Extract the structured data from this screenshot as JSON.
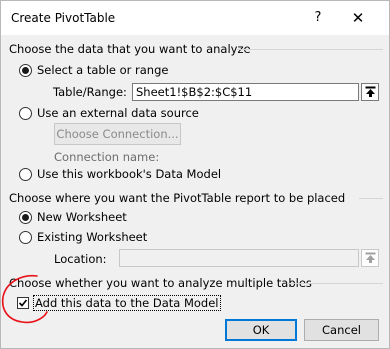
{
  "dialog": {
    "title": "Create PivotTable",
    "help_label": "?",
    "close_label": "✕"
  },
  "section_data": {
    "heading": "Choose the data that you want to analyze",
    "select_table_label": "Select a table or range",
    "select_table_selected": true,
    "table_range_label": "Table/Range:",
    "table_range_value": "Sheet1!$B$2:$C$11",
    "external_source_label": "Use an external data source",
    "external_source_selected": false,
    "choose_connection_label": "Choose Connection...",
    "connection_name_label": "Connection name:",
    "data_model_label": "Use this workbook's Data Model",
    "data_model_selected": false
  },
  "section_placement": {
    "heading": "Choose where you want the PivotTable report to be placed",
    "new_worksheet_label": "New Worksheet",
    "new_worksheet_selected": true,
    "existing_worksheet_label": "Existing Worksheet",
    "existing_worksheet_selected": false,
    "location_label": "Location:",
    "location_value": ""
  },
  "section_multiple": {
    "heading": "Choose whether you want to analyze multiple tables",
    "add_to_model_label": "Add this data to the Data Model",
    "add_to_model_checked": true
  },
  "buttons": {
    "ok_label": "OK",
    "cancel_label": "Cancel"
  },
  "icons": {
    "collapse": "collapse-dialog-icon",
    "checkmark": "checkmark-icon",
    "annotation": "red-hand-drawn-circle"
  },
  "colors": {
    "annotation": "#e8141b",
    "default_button_border": "#0078d7"
  }
}
